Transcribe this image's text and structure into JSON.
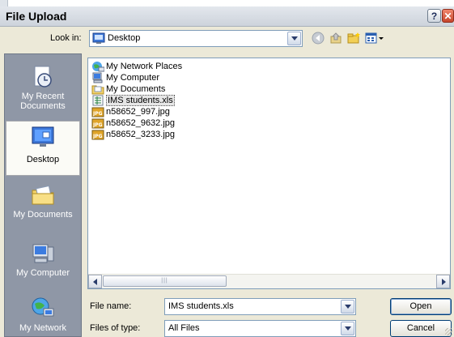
{
  "window": {
    "title": "File Upload",
    "help_glyph": "?",
    "close_glyph": "✕"
  },
  "lookin": {
    "label": "Look in:",
    "value": "Desktop"
  },
  "toolbar": {
    "icons": [
      "back-icon",
      "up-folder-icon",
      "new-folder-icon",
      "views-menu-icon"
    ]
  },
  "places": [
    {
      "label": "My Recent Documents",
      "icon": "recent-documents-icon",
      "active": false
    },
    {
      "label": "Desktop",
      "icon": "desktop-icon",
      "active": true
    },
    {
      "label": "My Documents",
      "icon": "my-documents-icon",
      "active": false
    },
    {
      "label": "My Computer",
      "icon": "my-computer-icon",
      "active": false
    },
    {
      "label": "My Network",
      "icon": "my-network-icon",
      "active": false
    }
  ],
  "files": [
    {
      "name": "My Network Places",
      "icon": "network-places-icon",
      "selected": false
    },
    {
      "name": "My Computer",
      "icon": "computer-icon",
      "selected": false
    },
    {
      "name": "My Documents",
      "icon": "folder-icon",
      "selected": false
    },
    {
      "name": "IMS students.xls",
      "icon": "excel-file-icon",
      "selected": true
    },
    {
      "name": "n58652_997.jpg",
      "icon": "jpg-file-icon",
      "selected": false
    },
    {
      "name": "n58652_9632.jpg",
      "icon": "jpg-file-icon",
      "selected": false
    },
    {
      "name": "n58652_3233.jpg",
      "icon": "jpg-file-icon",
      "selected": false
    }
  ],
  "filename": {
    "label": "File name:",
    "value": "IMS students.xls"
  },
  "filetype": {
    "label": "Files of type:",
    "value": "All Files"
  },
  "buttons": {
    "open": "Open",
    "cancel": "Cancel"
  },
  "colors": {
    "places_bar": "#8f97a6",
    "dialog_bg": "#ece9d8",
    "input_border": "#7f9db9"
  }
}
